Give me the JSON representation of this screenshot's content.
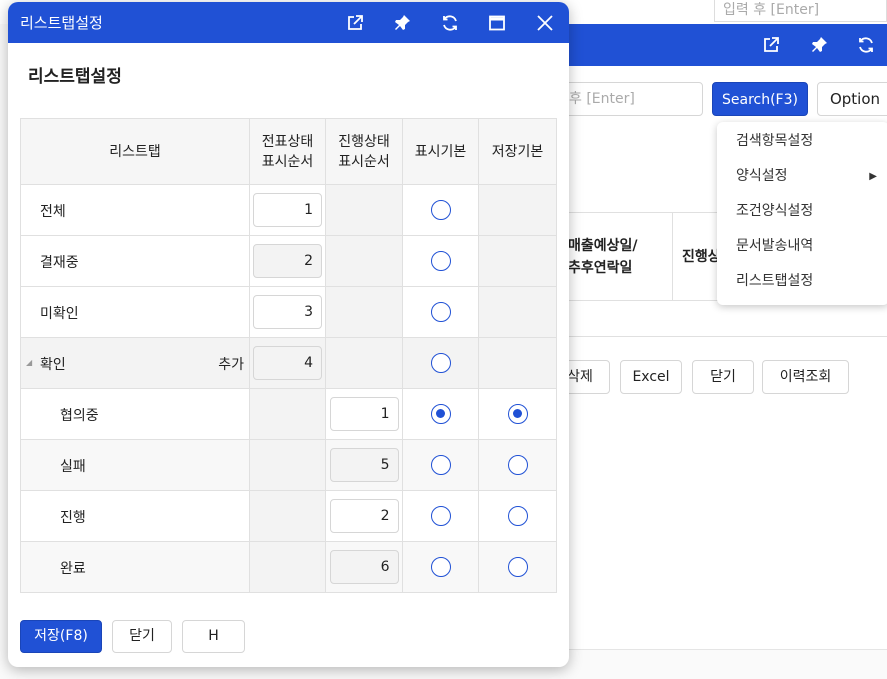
{
  "background": {
    "top_input_placeholder": "입력 후 [Enter]",
    "search_placeholder": "후 [Enter]",
    "search_button": "Search(F3)",
    "option_button": "Option",
    "col_sales_date": "매출예상일/\n추후연락일",
    "col_progress": "진행상",
    "buttons": {
      "delete": "삭제",
      "excel": "Excel",
      "close": "닫기",
      "history": "이력조회"
    }
  },
  "dropdown": {
    "items": [
      {
        "label": "검색항목설정"
      },
      {
        "label": "양식설정",
        "has_submenu": true
      },
      {
        "label": "조건양식설정"
      },
      {
        "label": "문서발송내역"
      },
      {
        "label": "리스트탭설정"
      }
    ]
  },
  "modal": {
    "title": "리스트탭설정",
    "heading": "리스트탭설정",
    "columns": {
      "tab": "리스트탭",
      "doc_status_order": "전표상태\n표시순서",
      "progress_status_order": "진행상태\n표시순서",
      "display_default": "표시기본",
      "save_default": "저장기본"
    },
    "rows": [
      {
        "name": "전체",
        "doc_order": "1",
        "doc_enabled": true,
        "display_default": false
      },
      {
        "name": "결재중",
        "doc_order": "2",
        "doc_enabled": false,
        "display_default": false
      },
      {
        "name": "미확인",
        "doc_order": "3",
        "doc_enabled": true,
        "display_default": false
      },
      {
        "name": "확인",
        "doc_order": "4",
        "doc_enabled": false,
        "display_default": false,
        "add_label": "추가"
      }
    ],
    "sub_rows": [
      {
        "name": "협의중",
        "progress_order": "1",
        "enabled": true,
        "display_default": true,
        "save_default": true
      },
      {
        "name": "실패",
        "progress_order": "5",
        "enabled": false,
        "display_default": false,
        "save_default": false
      },
      {
        "name": "진행",
        "progress_order": "2",
        "enabled": true,
        "display_default": false,
        "save_default": false
      },
      {
        "name": "완료",
        "progress_order": "6",
        "enabled": false,
        "display_default": false,
        "save_default": false
      }
    ],
    "footer": {
      "save": "저장(F8)",
      "close": "닫기",
      "h": "H"
    }
  },
  "colors": {
    "accent": "#2051d5"
  }
}
